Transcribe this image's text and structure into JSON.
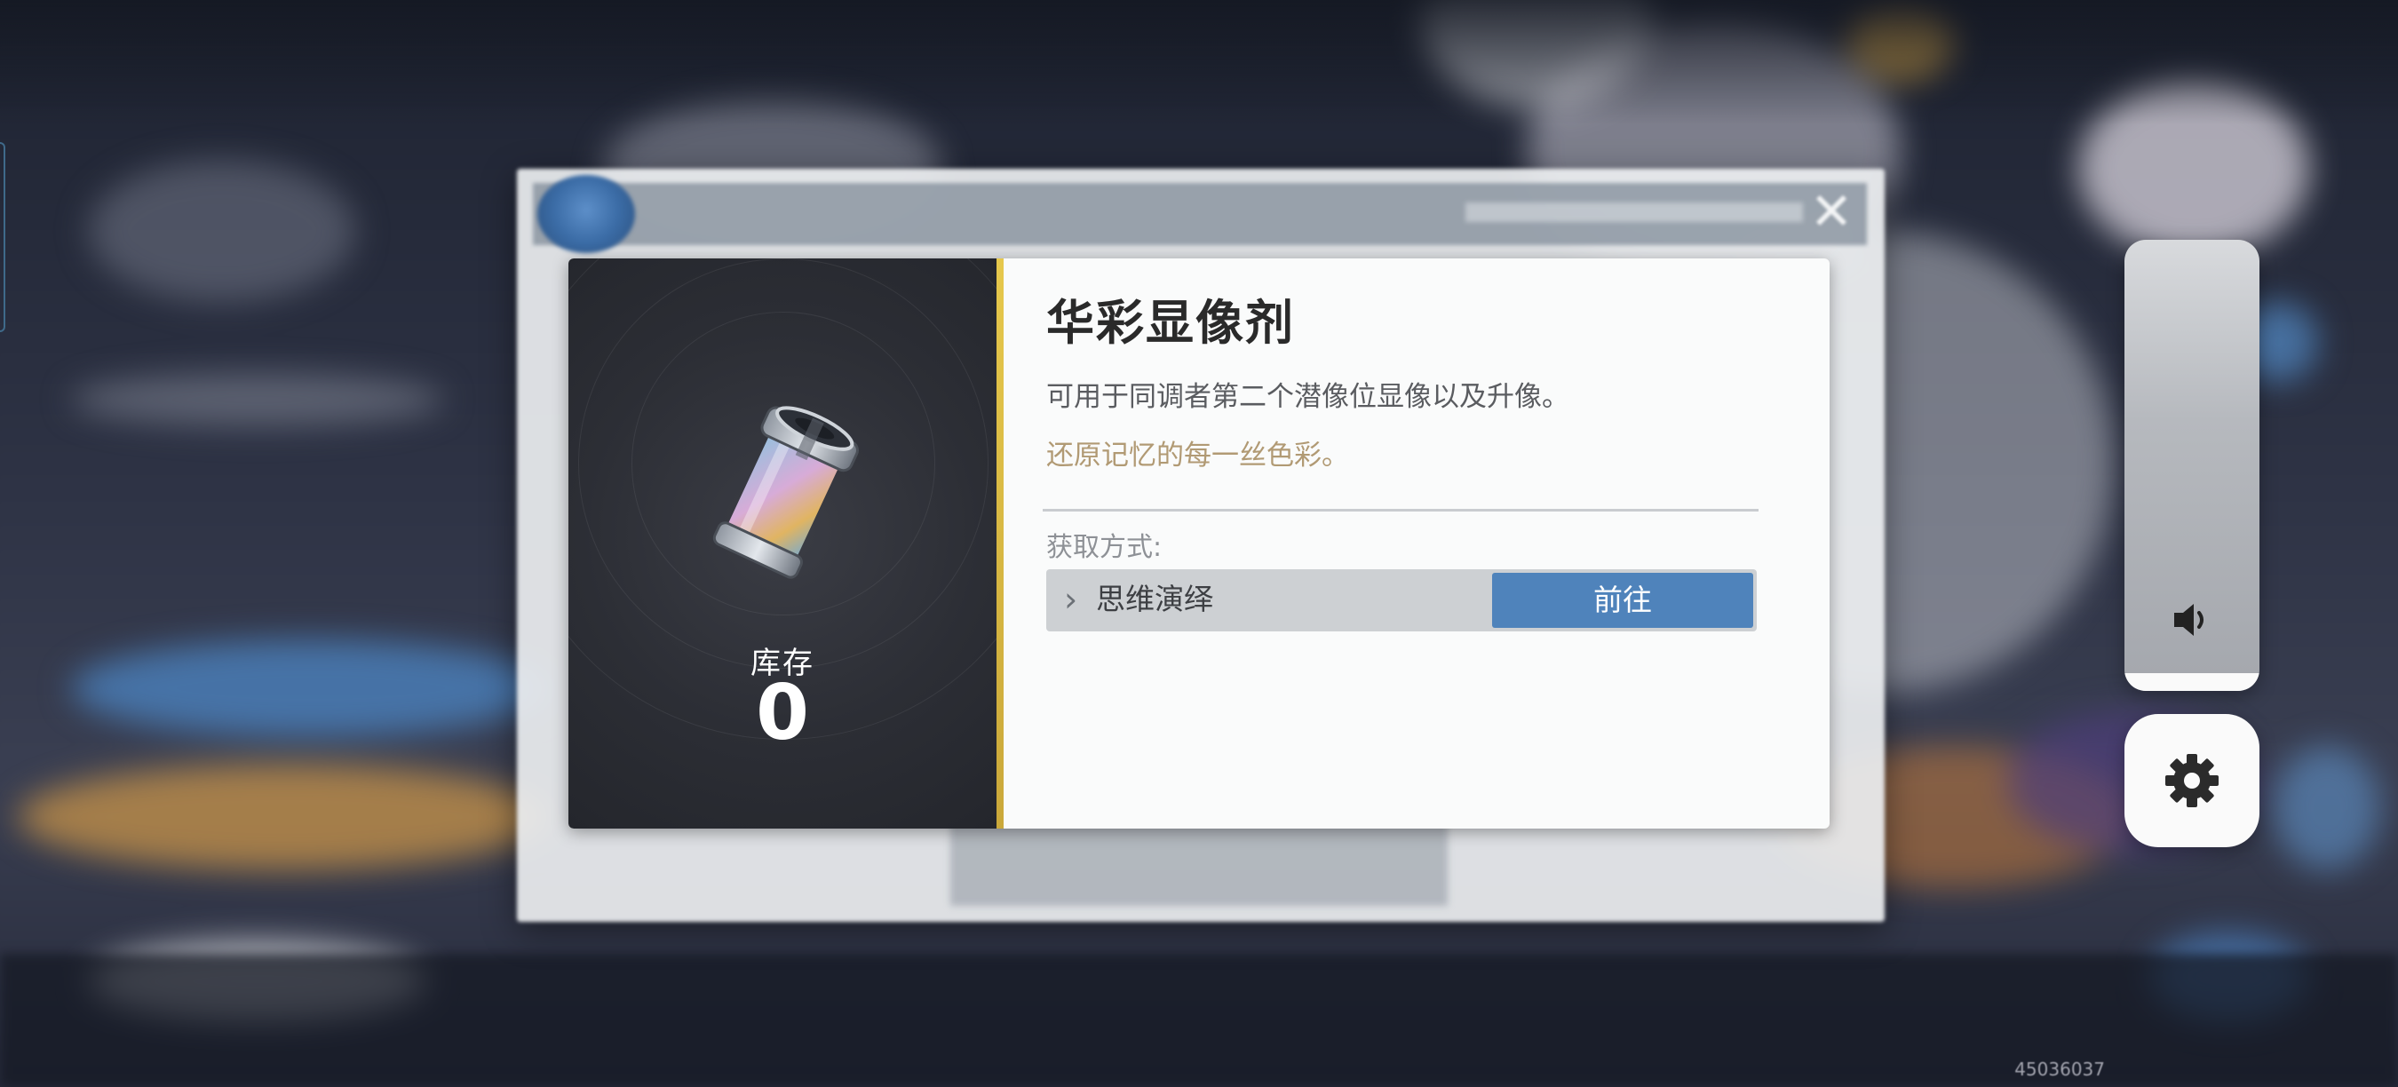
{
  "item": {
    "name": "华彩显像剂",
    "description": "可用于同调者第二个潜像位显像以及升像。",
    "flavor_text": "还原记忆的每一丝色彩。",
    "stock_label": "库存",
    "stock_count": "0"
  },
  "acquire": {
    "label": "获取方式:",
    "sources": [
      {
        "name": "思维演绎",
        "button_label": "前往"
      }
    ]
  },
  "overlay": {
    "volume_level": 0.04
  },
  "footer": {
    "build_id": "45036037"
  },
  "colors": {
    "accent_gold": "#e6c84c",
    "button_blue": "#4f83bb",
    "flavor_text": "#b19a74"
  },
  "icons": [
    "close-icon",
    "chevron-right-icon",
    "speaker-icon",
    "gear-icon",
    "item-canister-icon"
  ]
}
